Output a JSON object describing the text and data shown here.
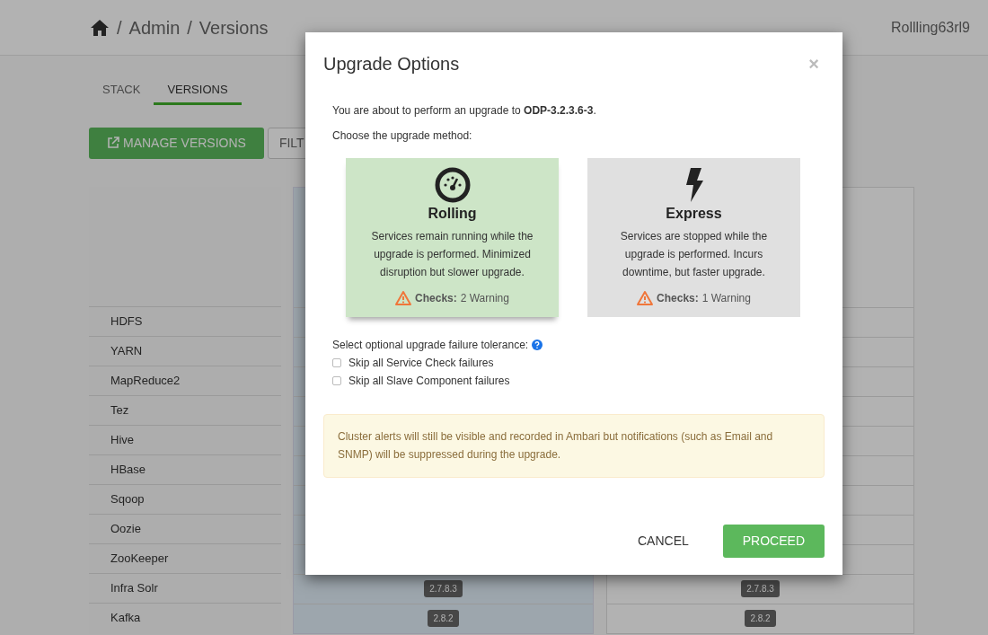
{
  "breadcrumb": {
    "items": [
      "Admin",
      "Versions"
    ],
    "separator": "/"
  },
  "user": "Rollling63rl9",
  "tabs": [
    {
      "label": "STACK",
      "selected": false
    },
    {
      "label": "VERSIONS",
      "selected": true
    }
  ],
  "toolbar": {
    "manage_button": "MANAGE VERSIONS",
    "filter_button": "FILT"
  },
  "table": {
    "rows": [
      {
        "service": "HDFS"
      },
      {
        "service": "YARN"
      },
      {
        "service": "MapReduce2"
      },
      {
        "service": "Tez"
      },
      {
        "service": "Hive"
      },
      {
        "service": "HBase"
      },
      {
        "service": "Sqoop"
      },
      {
        "service": "Oozie"
      },
      {
        "service": "ZooKeeper"
      },
      {
        "service": "Infra Solr",
        "versions": [
          "2.7.8.3",
          "2.7.8.3"
        ]
      },
      {
        "service": "Kafka",
        "versions": [
          "2.8.2",
          "2.8.2"
        ]
      }
    ]
  },
  "modal": {
    "title": "Upgrade Options",
    "close": "×",
    "intro": "You are about to perform an upgrade to **ODP-3.2.3.6-3**.",
    "choose": "Choose the upgrade method:",
    "methods": [
      {
        "kind": "gauge",
        "title": "Rolling",
        "description": "Services remain running while the upgrade is performed. Minimized disruption but slower upgrade.",
        "checks_label": "Checks:",
        "checks_value": "2 Warning",
        "selected": true
      },
      {
        "kind": "bolt",
        "title": "Express",
        "description": "Services are stopped while the upgrade is performed. Incurs downtime, but faster upgrade.",
        "checks_label": "Checks:",
        "checks_value": "1 Warning",
        "selected": false
      }
    ],
    "tolerance_label": "Select optional upgrade failure tolerance:",
    "options": [
      {
        "label": "Skip all Service Check failures",
        "checked": false
      },
      {
        "label": "Skip all Slave Component failures",
        "checked": false
      }
    ],
    "alert": "Cluster alerts will still be visible and recorded in Ambari but notifications (such as Email and SNMP) will be suppressed during the upgrade.",
    "buttons": {
      "cancel": "CANCEL",
      "proceed": "PROCEED"
    }
  }
}
